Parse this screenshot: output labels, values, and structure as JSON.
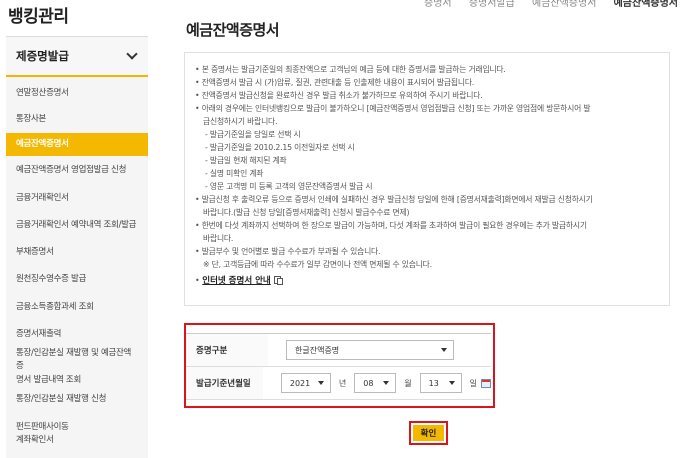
{
  "breadcrumb": {
    "items": [
      "증명서",
      "증명서발급",
      "예금잔액증명서",
      "예금잔액증명서"
    ]
  },
  "sidebar": {
    "title": "뱅킹관리",
    "group_label": "제증명발급",
    "items": [
      {
        "label": "연말정산증명서"
      },
      {
        "label": "통장사본"
      },
      {
        "label": "예금잔액증명서"
      },
      {
        "label": "예금잔액증명서 영업점발급 신청"
      },
      {
        "label": "금융거래확인서"
      },
      {
        "label": "금융거래확인서 예약내역 조회/발급"
      },
      {
        "label": "부채증명서"
      },
      {
        "label": "원천징수영수증 발급"
      },
      {
        "label": "금융소득종합과세 조회"
      },
      {
        "label": "증명서재출력"
      },
      {
        "label": "통장/인감분실 재발행 및 예금잔액증",
        "label2": "명서 발급내역 조회"
      },
      {
        "label": "통장/인감분실 재발행 신청"
      },
      {
        "label": "펀드판매사이동",
        "label2": "계좌확인서"
      }
    ]
  },
  "main": {
    "title": "예금잔액증명서",
    "notice": {
      "lines": [
        {
          "t": "b",
          "text": "본 증명서는 발급기준일의 최종잔액으로 고객님의 예금 등에 대한 증명서를 발급하는 거래입니다."
        },
        {
          "t": "b",
          "text": "잔액증명서 발급 시 (가)압류, 질권, 관련대출 등 인출제한 내용이 표시되어 발급됩니다."
        },
        {
          "t": "b",
          "text": "잔액증명서 발급신청을 완료하신 경우 발급 취소가 불가하므로 유의하여 주시기 바랍니다."
        },
        {
          "t": "b",
          "text": "아래의 경우에는 인터넷뱅킹으로 발급이 불가하오니 [예금잔액증명서 영업점발급 신청] 또는 가까운 영업점에 방문하시어 발"
        },
        {
          "t": "cont",
          "text": "급신청하시기 바랍니다."
        },
        {
          "t": "sub",
          "text": "발급기준일을 당일로 선택 시"
        },
        {
          "t": "sub",
          "text": "발급기준일을 2010.2.15 이전일자로 선택 시"
        },
        {
          "t": "sub",
          "text": "발급일 현재 해지된 계좌"
        },
        {
          "t": "sub",
          "text": "실명 미확인 계좌"
        },
        {
          "t": "sub",
          "text": "영문 고객명 미 등록 고객의 영문잔액증명서 발급 시"
        },
        {
          "t": "b",
          "text": "발급신청 후 출력오류 등으로 증명서 인쇄에 실패하신 경우 발급신청 당일에 한해 [증명서재출력]화면에서 재발급 신청하시기"
        },
        {
          "t": "cont",
          "text": "바랍니다.(발급 신청 당일[증명서재출력] 신청시 발급수수료 면제)"
        },
        {
          "t": "b",
          "text": "한번에 다섯 계좌까지 선택하여 한 장으로 발급이 가능하며, 다섯 계좌를 초과하여 발급이 필요한 경우에는 추가 발급하시기"
        },
        {
          "t": "cont",
          "text": "바랍니다."
        },
        {
          "t": "b",
          "text": "발급부수 및 언어별로 발급 수수료가 부과될 수 있습니다."
        },
        {
          "t": "note",
          "text": "※ 단, 고객등급에 따라 수수료가 일부 감면이나 전액 면제될 수 있습니다."
        }
      ],
      "link_label": "인터넷 증명서 안내"
    },
    "form": {
      "doc_type_label": "증명구분",
      "doc_type_value": "한글잔액증명",
      "date_label": "발급기준년월일",
      "year": "2021",
      "year_unit": "년",
      "month": "08",
      "month_unit": "월",
      "day": "13",
      "day_unit": "일"
    },
    "confirm_label": "확인"
  }
}
